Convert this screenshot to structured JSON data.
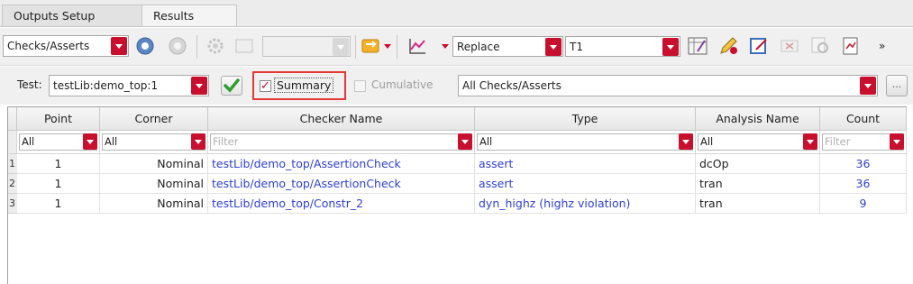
{
  "tabs": [
    "Outputs Setup",
    "Results"
  ],
  "toolbar": {
    "view_combo": "Checks/Asserts",
    "replace_combo": "Replace",
    "history_combo": "T1",
    "overflow": "»"
  },
  "filterbar": {
    "test_label": "Test:",
    "test_value": "testLib:demo_top:1",
    "summary_label": "Summary",
    "summary_checked": "✓",
    "cumulative_label": "Cumulative",
    "checks_filter": "All Checks/Asserts",
    "more_button": "..."
  },
  "table": {
    "columns": [
      "Point",
      "Corner",
      "Checker Name",
      "Type",
      "Analysis Name",
      "Count"
    ],
    "filters": [
      "All",
      "All",
      "Filter",
      "All",
      "All",
      "Filter"
    ],
    "rows": [
      {
        "num": "1",
        "point": "1",
        "corner": "Nominal",
        "checker": "testLib/demo_top/AssertionCheck",
        "type": "assert",
        "analysis": "dcOp",
        "count": "36"
      },
      {
        "num": "2",
        "point": "1",
        "corner": "Nominal",
        "checker": "testLib/demo_top/AssertionCheck",
        "type": "assert",
        "analysis": "tran",
        "count": "36"
      },
      {
        "num": "3",
        "point": "1",
        "corner": "Nominal",
        "checker": "testLib/demo_top/Constr_2",
        "type": "dyn_highz (highz violation)",
        "analysis": "tran",
        "count": "9"
      }
    ]
  }
}
